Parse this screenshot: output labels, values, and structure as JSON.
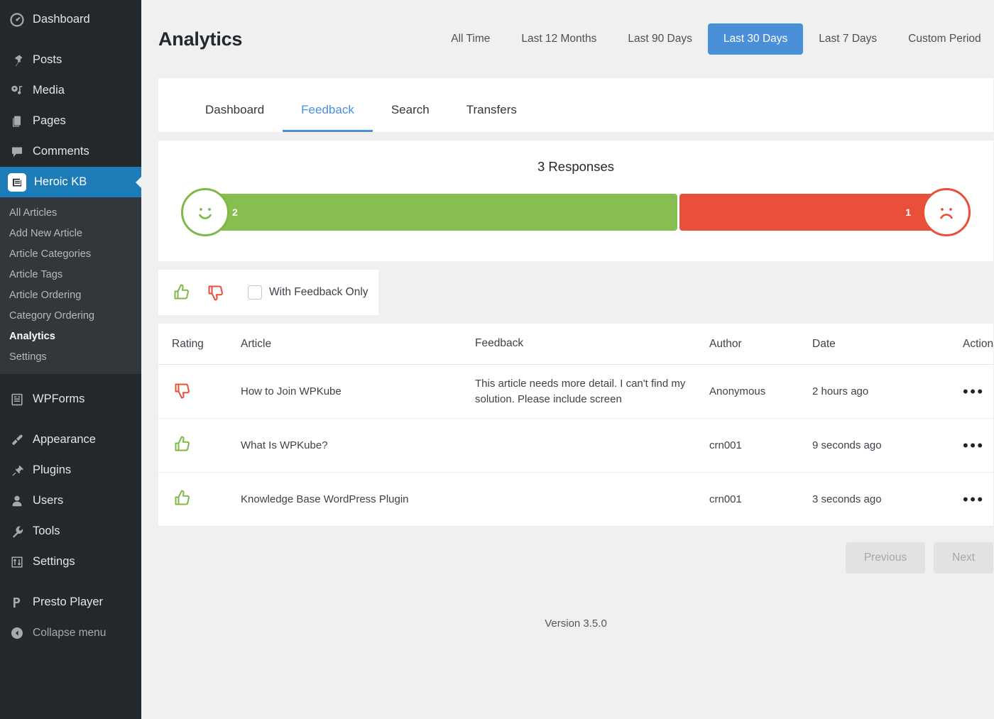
{
  "sidebar": {
    "items": [
      {
        "label": "Dashboard",
        "icon": "dashboard-icon"
      },
      {
        "label": "Posts",
        "icon": "pin-icon"
      },
      {
        "label": "Media",
        "icon": "media-icon"
      },
      {
        "label": "Pages",
        "icon": "pages-icon"
      },
      {
        "label": "Comments",
        "icon": "comments-icon"
      },
      {
        "label": "Heroic KB",
        "icon": "book-icon",
        "active": true
      }
    ],
    "submenu": [
      {
        "label": "All Articles"
      },
      {
        "label": "Add New Article"
      },
      {
        "label": "Article Categories"
      },
      {
        "label": "Article Tags"
      },
      {
        "label": "Article Ordering"
      },
      {
        "label": "Category Ordering"
      },
      {
        "label": "Analytics",
        "current": true
      },
      {
        "label": "Settings"
      }
    ],
    "items2": [
      {
        "label": "WPForms",
        "icon": "forms-icon"
      }
    ],
    "items3": [
      {
        "label": "Appearance",
        "icon": "brush-icon"
      },
      {
        "label": "Plugins",
        "icon": "plug-icon"
      },
      {
        "label": "Users",
        "icon": "user-icon"
      },
      {
        "label": "Tools",
        "icon": "wrench-icon"
      },
      {
        "label": "Settings",
        "icon": "settings-icon"
      }
    ],
    "items4": [
      {
        "label": "Presto Player",
        "icon": "presto-icon"
      }
    ],
    "collapse": {
      "label": "Collapse menu",
      "icon": "collapse-icon"
    }
  },
  "header": {
    "title": "Analytics",
    "periods": [
      {
        "label": "All Time",
        "active": false
      },
      {
        "label": "Last 12 Months",
        "active": false
      },
      {
        "label": "Last 90 Days",
        "active": false
      },
      {
        "label": "Last 30 Days",
        "active": true
      },
      {
        "label": "Last 7 Days",
        "active": false
      },
      {
        "label": "Custom Period",
        "active": false
      }
    ],
    "accent_color": "#4a90d9"
  },
  "tabs": [
    {
      "label": "Dashboard",
      "active": false
    },
    {
      "label": "Feedback",
      "active": true
    },
    {
      "label": "Search",
      "active": false
    },
    {
      "label": "Transfers",
      "active": false
    }
  ],
  "responses": {
    "title": "3 Responses",
    "positive_value": "2",
    "negative_value": "1",
    "positive_color": "#86bf4f",
    "negative_color": "#e8503a"
  },
  "chart_data": {
    "type": "bar",
    "title": "3 Responses",
    "categories": [
      "Positive",
      "Negative"
    ],
    "values": [
      2,
      1
    ],
    "total": 3,
    "colors": [
      "#86bf4f",
      "#e8503a"
    ],
    "orientation": "horizontal-stacked",
    "xlabel": "",
    "ylabel": ""
  },
  "filterbar": {
    "thumb_up": "thumbs-up",
    "thumb_down": "thumbs-down",
    "checkbox_label": "With Feedback Only",
    "checkbox_checked": false
  },
  "table": {
    "columns": [
      "Rating",
      "Article",
      "Feedback",
      "Author",
      "Date",
      "Actions"
    ],
    "rows": [
      {
        "rating": "down",
        "article": "How to Join WPKube",
        "feedback": "This article needs more detail. I can't find my solution. Please include screen",
        "author": "Anonymous",
        "date": "2 hours ago",
        "actions": "•••"
      },
      {
        "rating": "up",
        "article": "What Is WPKube?",
        "feedback": "",
        "author": "crn001",
        "date": "9 seconds ago",
        "actions": "•••"
      },
      {
        "rating": "up",
        "article": "Knowledge Base WordPress Plugin",
        "feedback": "",
        "author": "crn001",
        "date": "3 seconds ago",
        "actions": "•••"
      }
    ]
  },
  "pagination": {
    "previous": "Previous",
    "next": "Next",
    "previous_disabled": true,
    "next_disabled": true
  },
  "footer": {
    "version": "Version 3.5.0"
  }
}
